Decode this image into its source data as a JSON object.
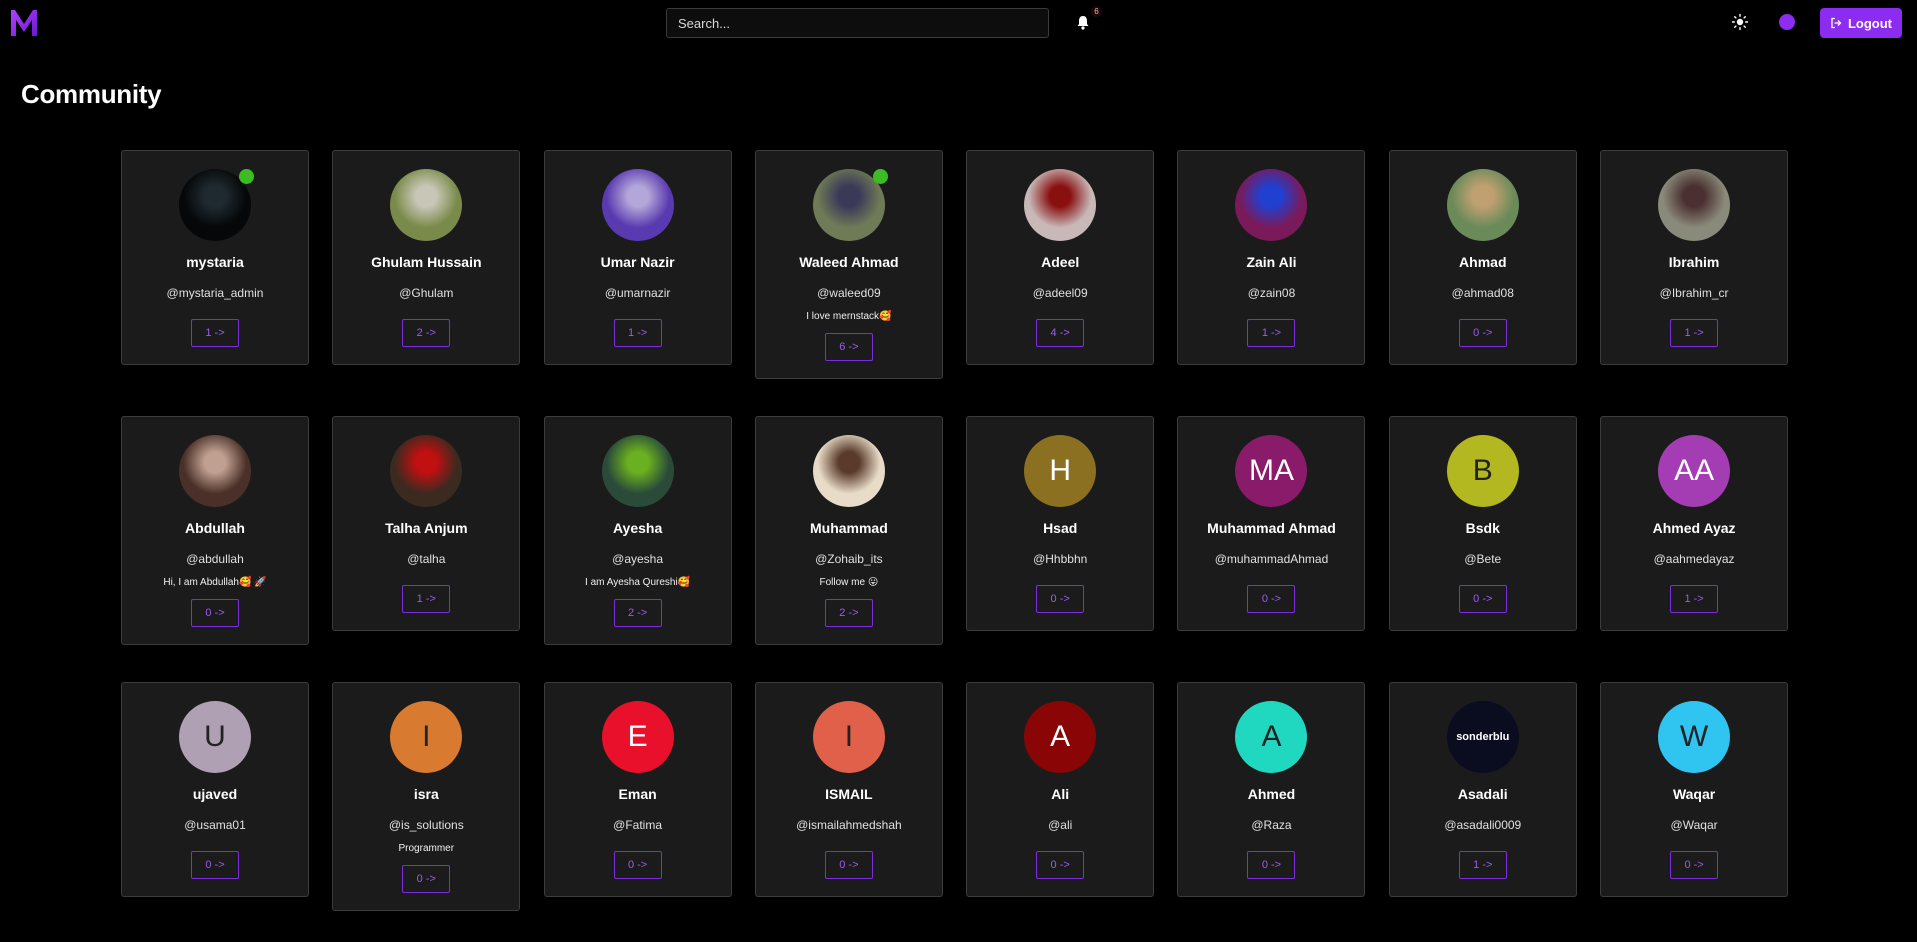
{
  "header": {
    "logo_letter": "M",
    "search_placeholder": "Search...",
    "notification_count": "6",
    "logout_label": "Logout",
    "accent": "#8b2cf0"
  },
  "page_title": "Community",
  "users": [
    {
      "name": "mystaria",
      "handle": "@mystaria_admin",
      "bio": "",
      "count": "1 ->",
      "online": true,
      "avatar": {
        "type": "photo",
        "bg": "#050708",
        "fg": "#1f2a30"
      }
    },
    {
      "name": "Ghulam Hussain",
      "handle": "@Ghulam",
      "bio": "",
      "count": "2 ->",
      "online": false,
      "avatar": {
        "type": "photo",
        "bg": "#7a8a4a",
        "fg": "#c8c6b6"
      }
    },
    {
      "name": "Umar Nazir",
      "handle": "@umarnazir",
      "bio": "",
      "count": "1 ->",
      "online": false,
      "avatar": {
        "type": "photo",
        "bg": "#5a3ab0",
        "fg": "#b3a6d8"
      }
    },
    {
      "name": "Waleed Ahmad",
      "handle": "@waleed09",
      "bio": "I love mernstack🥰",
      "count": "6 ->",
      "online": true,
      "avatar": {
        "type": "photo",
        "bg": "#6f7a56",
        "fg": "#3a3a58"
      }
    },
    {
      "name": "Adeel",
      "handle": "@adeel09",
      "bio": "",
      "count": "4 ->",
      "online": false,
      "avatar": {
        "type": "photo",
        "bg": "#c8b8b8",
        "fg": "#8a1010"
      }
    },
    {
      "name": "Zain Ali",
      "handle": "@zain08",
      "bio": "",
      "count": "1 ->",
      "online": false,
      "avatar": {
        "type": "photo",
        "bg": "#7a1a5a",
        "fg": "#2040d0"
      }
    },
    {
      "name": "Ahmad",
      "handle": "@ahmad08",
      "bio": "",
      "count": "0 ->",
      "online": false,
      "avatar": {
        "type": "photo",
        "bg": "#6a8a5a",
        "fg": "#c0a070"
      }
    },
    {
      "name": "Ibrahim",
      "handle": "@Ibrahim_cr",
      "bio": "",
      "count": "1 ->",
      "online": false,
      "avatar": {
        "type": "photo",
        "bg": "#8a8a7a",
        "fg": "#4a3030"
      }
    },
    {
      "name": "Abdullah",
      "handle": "@abdullah",
      "bio": "Hi, I am Abdullah🥰 🚀",
      "count": "0 ->",
      "online": false,
      "avatar": {
        "type": "photo",
        "bg": "#4a3028",
        "fg": "#c0a090"
      }
    },
    {
      "name": "Talha Anjum",
      "handle": "@talha",
      "bio": "",
      "count": "1 ->",
      "online": false,
      "avatar": {
        "type": "photo",
        "bg": "#3a2a20",
        "fg": "#c01010"
      }
    },
    {
      "name": "Ayesha",
      "handle": "@ayesha",
      "bio": "I am Ayesha Qureshi🥰",
      "count": "2 ->",
      "online": false,
      "avatar": {
        "type": "photo",
        "bg": "#2a4a3a",
        "fg": "#6ab020"
      }
    },
    {
      "name": "Muhammad",
      "handle": "@Zohaib_its",
      "bio": "Follow me 😛",
      "count": "2 ->",
      "online": false,
      "avatar": {
        "type": "photo",
        "bg": "#e8dcc8",
        "fg": "#5a3a2a"
      }
    },
    {
      "name": "Hsad",
      "handle": "@Hhbbhn",
      "bio": "",
      "count": "0 ->",
      "online": false,
      "avatar": {
        "type": "letters",
        "text": "H",
        "bg": "#8a7020",
        "fg": "#ffffff"
      }
    },
    {
      "name": "Muhammad Ahmad",
      "handle": "@muhammadAhmad",
      "bio": "",
      "count": "0 ->",
      "online": false,
      "avatar": {
        "type": "letters",
        "text": "MA",
        "bg": "#8a1a6a",
        "fg": "#ffffff"
      }
    },
    {
      "name": "Bsdk",
      "handle": "@Bete",
      "bio": "",
      "count": "0 ->",
      "online": false,
      "avatar": {
        "type": "letters",
        "text": "B",
        "bg": "#b4b820",
        "fg": "#222222"
      }
    },
    {
      "name": "Ahmed Ayaz",
      "handle": "@aahmedayaz",
      "bio": "",
      "count": "1 ->",
      "online": false,
      "avatar": {
        "type": "letters",
        "text": "AA",
        "bg": "#a43cb4",
        "fg": "#ffffff"
      }
    },
    {
      "name": "ujaved",
      "handle": "@usama01",
      "bio": "",
      "count": "0 ->",
      "online": false,
      "avatar": {
        "type": "letters",
        "text": "U",
        "bg": "#b0a0b4",
        "fg": "#222222"
      }
    },
    {
      "name": "isra",
      "handle": "@is_solutions",
      "bio": "Programmer",
      "count": "0 ->",
      "online": false,
      "avatar": {
        "type": "letters",
        "text": "I",
        "bg": "#d87a30",
        "fg": "#222222"
      }
    },
    {
      "name": "Eman",
      "handle": "@Fatima",
      "bio": "",
      "count": "0 ->",
      "online": false,
      "avatar": {
        "type": "letters",
        "text": "E",
        "bg": "#e8102a",
        "fg": "#ffffff"
      }
    },
    {
      "name": "ISMAIL",
      "handle": "@ismailahmedshah",
      "bio": "",
      "count": "0 ->",
      "online": false,
      "avatar": {
        "type": "letters",
        "text": "I",
        "bg": "#e0604a",
        "fg": "#222222"
      }
    },
    {
      "name": "Ali",
      "handle": "@ali",
      "bio": "",
      "count": "0 ->",
      "online": false,
      "avatar": {
        "type": "letters",
        "text": "A",
        "bg": "#8a0606",
        "fg": "#ffffff"
      }
    },
    {
      "name": "Ahmed",
      "handle": "@Raza",
      "bio": "",
      "count": "0 ->",
      "online": false,
      "avatar": {
        "type": "letters",
        "text": "A",
        "bg": "#20d8c0",
        "fg": "#222222"
      }
    },
    {
      "name": "Asadali",
      "handle": "@asadali0009",
      "bio": "",
      "count": "1 ->",
      "online": false,
      "avatar": {
        "type": "logo",
        "text": "sonderblu",
        "bg": "#0a0c20",
        "fg": "#ffffff"
      }
    },
    {
      "name": "Waqar",
      "handle": "@Waqar",
      "bio": "",
      "count": "0 ->",
      "online": false,
      "avatar": {
        "type": "letters",
        "text": "W",
        "bg": "#30c4f0",
        "fg": "#222222"
      }
    }
  ]
}
